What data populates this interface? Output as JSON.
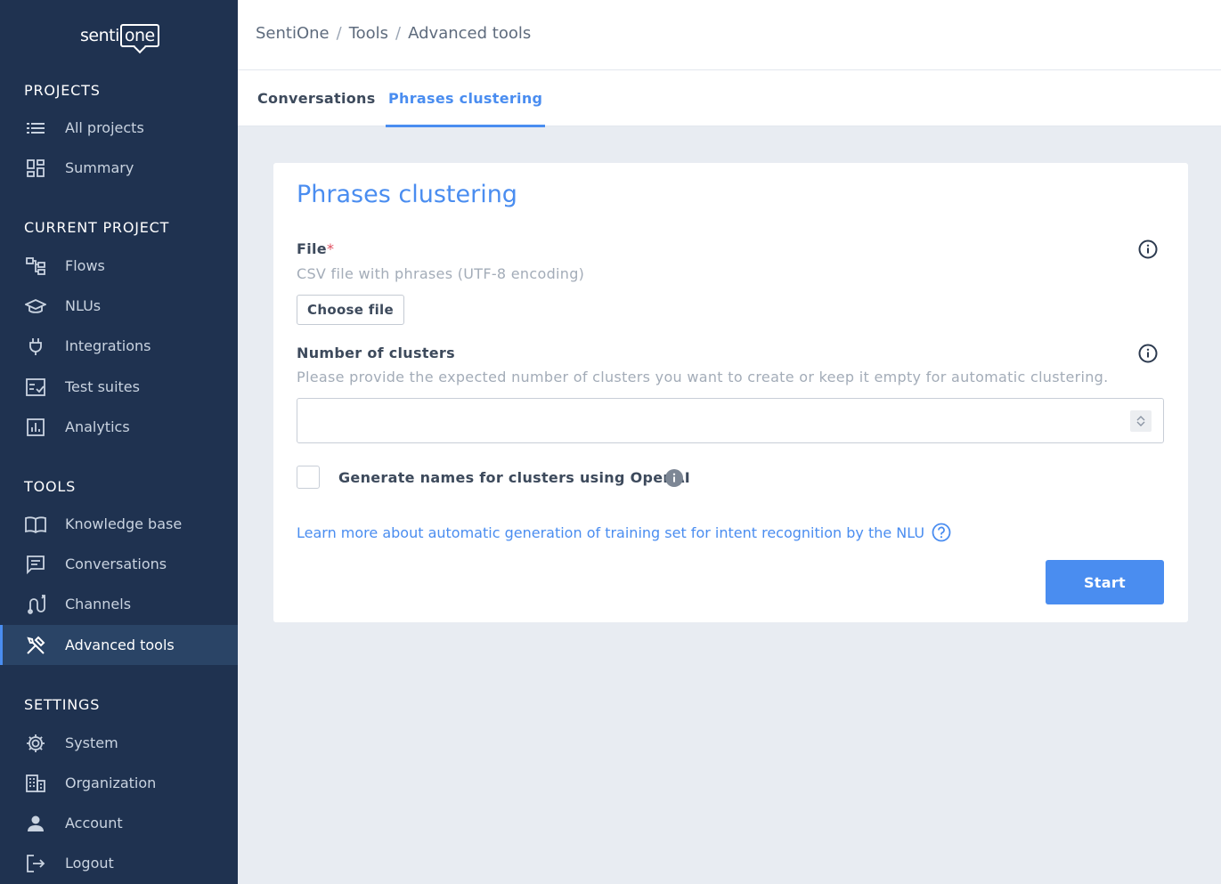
{
  "app": {
    "logo_left": "senti",
    "logo_right": "one"
  },
  "sidebar": {
    "sections": {
      "projects": "PROJECTS",
      "current_project": "CURRENT PROJECT",
      "tools": "TOOLS",
      "settings": "SETTINGS"
    },
    "items": {
      "all_projects": {
        "label": "All projects",
        "icon": "list-icon"
      },
      "summary": {
        "label": "Summary",
        "icon": "dashboard-icon"
      },
      "flows": {
        "label": "Flows",
        "icon": "flow-icon"
      },
      "nlus": {
        "label": "NLUs",
        "icon": "graduation-cap-icon"
      },
      "integrations": {
        "label": "Integrations",
        "icon": "plug-icon"
      },
      "test_suites": {
        "label": "Test suites",
        "icon": "checklist-icon"
      },
      "analytics": {
        "label": "Analytics",
        "icon": "bar-chart-icon"
      },
      "knowledge_base": {
        "label": "Knowledge base",
        "icon": "book-icon"
      },
      "conversations": {
        "label": "Conversations",
        "icon": "chat-icon"
      },
      "channels": {
        "label": "Channels",
        "icon": "channels-icon"
      },
      "advanced_tools": {
        "label": "Advanced tools",
        "icon": "tools-icon",
        "active": true
      },
      "system": {
        "label": "System",
        "icon": "gear-icon"
      },
      "organization": {
        "label": "Organization",
        "icon": "building-icon"
      },
      "account": {
        "label": "Account",
        "icon": "person-icon"
      },
      "logout": {
        "label": "Logout",
        "icon": "logout-icon"
      }
    }
  },
  "header": {
    "breadcrumb": [
      "SentiOne",
      "Tools",
      "Advanced tools"
    ],
    "separator": "/"
  },
  "tabs": [
    {
      "label": "Conversations",
      "active": false
    },
    {
      "label": "Phrases clustering",
      "active": true
    }
  ],
  "form": {
    "title": "Phrases clustering",
    "file": {
      "label": "File",
      "required_mark": "*",
      "help": "CSV file with phrases (UTF-8 encoding)",
      "button": "Choose file"
    },
    "clusters": {
      "label": "Number of clusters",
      "help": "Please provide the expected number of clusters you want to create or keep it empty for automatic clustering.",
      "value": ""
    },
    "openai": {
      "label": "Generate names for clusters using OpenAI",
      "checked": false
    },
    "learn_more": "Learn more about automatic generation of training set for intent recognition by the NLU",
    "start_button": "Start"
  },
  "colors": {
    "sidebar_bg": "#1f3250",
    "accent": "#4a8df0",
    "page_bg": "#e8ecf2"
  }
}
